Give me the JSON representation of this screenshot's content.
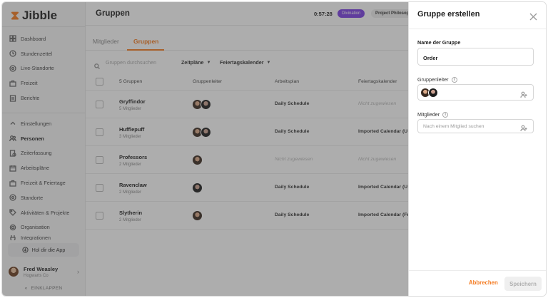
{
  "brand": {
    "name": "Jibble",
    "accent": "#f47a20"
  },
  "sidebar": {
    "items": [
      {
        "label": "Dashboard",
        "icon": "dashboard-icon"
      },
      {
        "label": "Stundenzettel",
        "icon": "clock-icon"
      },
      {
        "label": "Live-Standorte",
        "icon": "location-icon"
      },
      {
        "label": "Freizeit",
        "icon": "briefcase-icon"
      },
      {
        "label": "Berichte",
        "icon": "report-icon"
      }
    ],
    "settings_items": [
      {
        "label": "Einstellungen",
        "icon": "chevron-up-icon"
      },
      {
        "label": "Personen",
        "icon": "people-icon"
      },
      {
        "label": "Zeiterfassung",
        "icon": "time-tracking-icon"
      },
      {
        "label": "Arbeitspläne",
        "icon": "calendar-icon"
      },
      {
        "label": "Freizeit & Feiertage",
        "icon": "holiday-icon"
      },
      {
        "label": "Standorte",
        "icon": "pin-icon"
      },
      {
        "label": "Aktivitäten & Projekte",
        "icon": "tag-icon"
      },
      {
        "label": "Organisation",
        "icon": "gear-icon"
      },
      {
        "label": "Integrationen",
        "icon": "plug-icon"
      }
    ],
    "get_app": "Hol dir die App",
    "user": {
      "name": "Fred Weasley",
      "org": "Hogwarts Co"
    },
    "collapse": "EINKLAPPEN"
  },
  "header": {
    "title": "Gruppen",
    "timer": "0:57:28",
    "activity": "Divination",
    "project": "Project Philosop"
  },
  "tabs": {
    "members": "Mitglieder",
    "groups": "Gruppen"
  },
  "filters": {
    "search_placeholder": "Gruppen durchsuchen",
    "schedules": "Zeitpläne",
    "holiday_calendar": "Feiertagskalender"
  },
  "table": {
    "headers": {
      "name": "5 Gruppen",
      "leaders": "Gruppenleiter",
      "schedule": "Arbeitsplan",
      "calendar": "Feiertagskalender"
    },
    "rows": [
      {
        "name": "Gryffindor",
        "count": "5 Mitglieder",
        "leaders": 2,
        "schedule": "Daily Schedule",
        "schedule_assigned": true,
        "calendar": "Nicht zugewiesen",
        "calendar_assigned": false
      },
      {
        "name": "Hufflepuff",
        "count": "3 Mitglieder",
        "leaders": 2,
        "schedule": "Daily Schedule",
        "schedule_assigned": true,
        "calendar": "Imported Calendar (U",
        "calendar_assigned": true
      },
      {
        "name": "Professors",
        "count": "2 Mitglieder",
        "leaders": 1,
        "schedule": "Nicht zugewiesen",
        "schedule_assigned": false,
        "calendar": "Nicht zugewiesen",
        "calendar_assigned": false
      },
      {
        "name": "Ravenclaw",
        "count": "2 Mitglieder",
        "leaders": 1,
        "schedule": "Daily Schedule",
        "schedule_assigned": true,
        "calendar": "Imported Calendar (U",
        "calendar_assigned": true
      },
      {
        "name": "Slytherin",
        "count": "2 Mitglieder",
        "leaders": 1,
        "schedule": "Daily Schedule",
        "schedule_assigned": true,
        "calendar": "Imported Calendar (Fr",
        "calendar_assigned": true
      }
    ]
  },
  "drawer": {
    "title": "Gruppe erstellen",
    "name_label": "Name der Gruppe",
    "name_value": "Order",
    "leader_label": "Gruppenleiter",
    "members_label": "Mitglieder",
    "members_placeholder": "Nach einem Mitglied suchen",
    "cancel": "Abbrechen",
    "save": "Speichern"
  }
}
